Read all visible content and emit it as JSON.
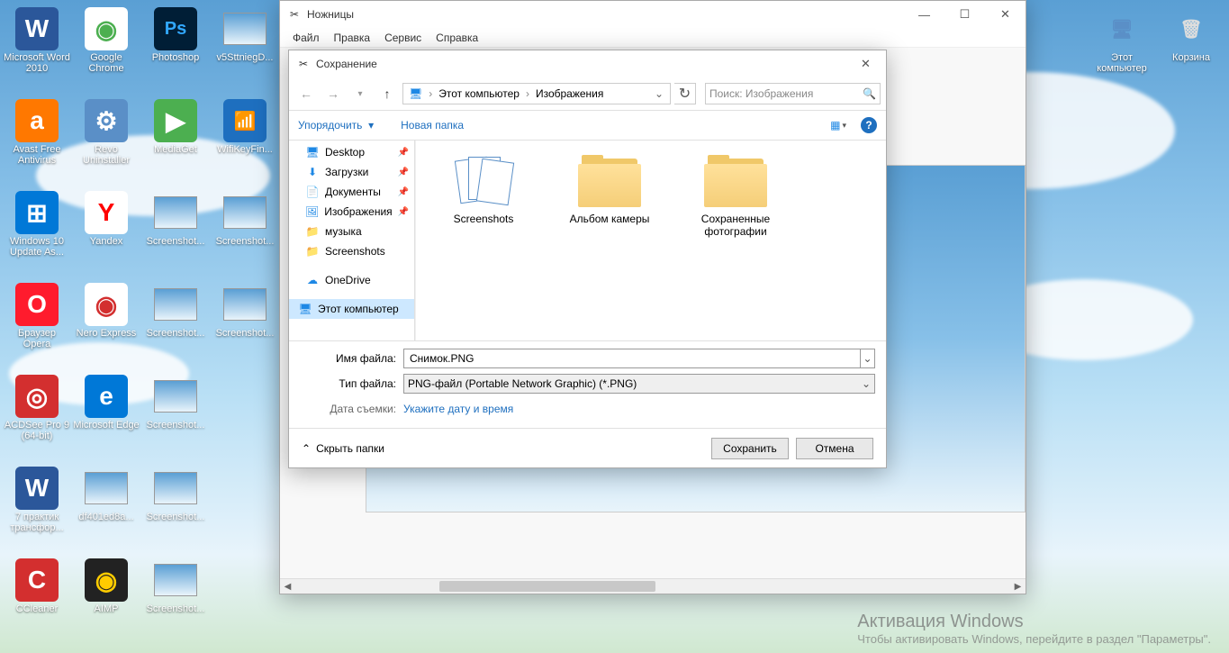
{
  "desktop": {
    "icons_left": [
      {
        "label": "Microsoft Word 2010",
        "emoji": "W",
        "bg": "#2b579a",
        "fg": "#fff"
      },
      {
        "label": "Google Chrome",
        "emoji": "◉",
        "bg": "#fff",
        "fg": "#4caf50"
      },
      {
        "label": "Photoshop",
        "emoji": "Ps",
        "bg": "#001e36",
        "fg": "#31a8ff"
      },
      {
        "label": "v5SttniegD...",
        "thumb": true
      },
      {
        "label": "Avast Free Antivirus",
        "emoji": "a",
        "bg": "#ff7800",
        "fg": "#fff"
      },
      {
        "label": "Revo Uninstaller",
        "emoji": "⚙",
        "bg": "#5a8fc7",
        "fg": "#fff"
      },
      {
        "label": "MediaGet",
        "emoji": "▶",
        "bg": "#4caf50",
        "fg": "#fff"
      },
      {
        "label": "WifiKeyFin...",
        "emoji": "📶",
        "bg": "#1e6fbf",
        "fg": "#ffcc00"
      },
      {
        "label": "Windows 10 Update As...",
        "emoji": "⊞",
        "bg": "#0078d7",
        "fg": "#fff"
      },
      {
        "label": "Yandex",
        "emoji": "Y",
        "bg": "#fff",
        "fg": "#ff0000"
      },
      {
        "label": "Screenshot...",
        "thumb": true
      },
      {
        "label": "Screenshot...",
        "thumb": true
      },
      {
        "label": "Браузер Opera",
        "emoji": "O",
        "bg": "#ff1b2d",
        "fg": "#fff"
      },
      {
        "label": "Nero Express",
        "emoji": "◉",
        "bg": "#fff",
        "fg": "#d32f2f"
      },
      {
        "label": "Screenshot...",
        "thumb": true
      },
      {
        "label": "Screenshot...",
        "thumb": true
      },
      {
        "label": "ACDSee Pro 9 (64-bit)",
        "emoji": "◎",
        "bg": "#d32f2f",
        "fg": "#fff"
      },
      {
        "label": "Microsoft Edge",
        "emoji": "e",
        "bg": "#0078d7",
        "fg": "#fff"
      },
      {
        "label": "Screenshot...",
        "thumb": true
      },
      {
        "label": "",
        "empty": true
      },
      {
        "label": "7 практик трансфор...",
        "emoji": "W",
        "bg": "#2b579a",
        "fg": "#fff"
      },
      {
        "label": "df401ed8a...",
        "thumb": true
      },
      {
        "label": "Screenshot...",
        "thumb": true
      },
      {
        "label": "",
        "empty": true
      },
      {
        "label": "CCleaner",
        "emoji": "C",
        "bg": "#d32f2f",
        "fg": "#fff"
      },
      {
        "label": "AIMP",
        "emoji": "◉",
        "bg": "#222",
        "fg": "#ffcc00"
      },
      {
        "label": "Screenshot...",
        "thumb": true
      }
    ],
    "icons_right": [
      {
        "label": "Этот компьютер",
        "emoji": "🖥",
        "bg": "transparent",
        "fg": "#5a8fc7"
      },
      {
        "label": "Корзина",
        "emoji": "🗑",
        "bg": "transparent",
        "fg": "#ddd"
      }
    ]
  },
  "snip": {
    "title": "Ножницы",
    "menu": [
      "Файл",
      "Правка",
      "Сервис",
      "Справка"
    ]
  },
  "save": {
    "title": "Сохранение",
    "breadcrumb": [
      "Этот компьютер",
      "Изображения"
    ],
    "search_ph": "Поиск: Изображения",
    "organize": "Упорядочить",
    "newfolder": "Новая папка",
    "tree": [
      {
        "label": "Desktop",
        "icon": "🖥",
        "pin": true,
        "color": "#1e88e5"
      },
      {
        "label": "Загрузки",
        "icon": "⬇",
        "pin": true,
        "color": "#1e88e5"
      },
      {
        "label": "Документы",
        "icon": "📄",
        "pin": true,
        "color": "#888"
      },
      {
        "label": "Изображения",
        "icon": "🖼",
        "pin": true,
        "color": "#1e88e5"
      },
      {
        "label": "музыка",
        "icon": "📁",
        "color": "#f5ce78"
      },
      {
        "label": "Screenshots",
        "icon": "📁",
        "color": "#f5ce78"
      },
      {
        "label": "OneDrive",
        "icon": "☁",
        "color": "#1e88e5",
        "space": true
      },
      {
        "label": "Этот компьютер",
        "icon": "🖥",
        "sel": true,
        "space": true,
        "color": "#1e88e5"
      }
    ],
    "folders": [
      {
        "label": "Screenshots",
        "type": "scr"
      },
      {
        "label": "Альбом камеры",
        "type": "folder"
      },
      {
        "label": "Сохраненные фотографии",
        "type": "folder"
      }
    ],
    "filename_label": "Имя файла:",
    "filename": "Снимок.PNG",
    "filetype_label": "Тип файла:",
    "filetype": "PNG-файл (Portable Network Graphic) (*.PNG)",
    "date_label": "Дата съемки:",
    "date_link": "Укажите дату и время",
    "hide": "Скрыть папки",
    "save_btn": "Сохранить",
    "cancel_btn": "Отмена"
  },
  "watermark": {
    "t1": "Активация Windows",
    "t2": "Чтобы активировать Windows, перейдите в раздел \"Параметры\"."
  }
}
